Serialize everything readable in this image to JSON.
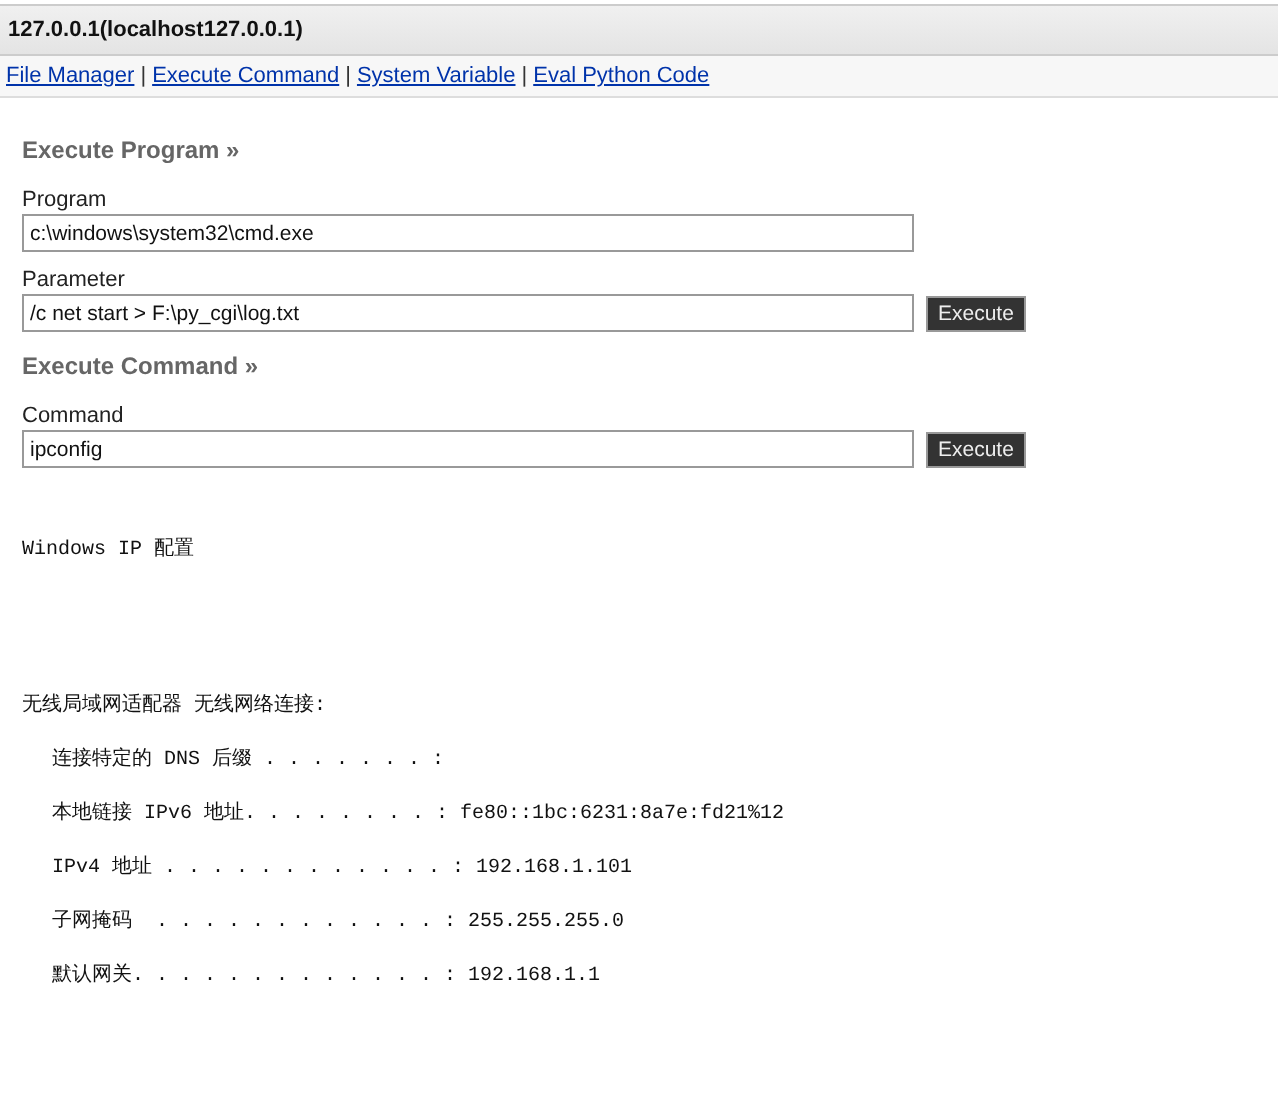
{
  "title": "127.0.0.1(localhost127.0.0.1)",
  "nav": [
    "File Manager",
    "Execute Command",
    "System Variable",
    "Eval Python Code"
  ],
  "nav_separators": [
    "|",
    "|",
    "|"
  ],
  "sections": [
    {
      "heading": "Execute Program »",
      "fields": [
        {
          "label": "Program",
          "value": "c:\\windows\\system32\\cmd.exe"
        },
        {
          "label": "Parameter",
          "value": "/c net start > F:\\py_cgi\\log.txt",
          "button": "Execute"
        }
      ]
    },
    {
      "heading": "Execute Command »",
      "fields": [
        {
          "label": "Command",
          "value": "ipconfig",
          "button": "Execute"
        }
      ]
    }
  ],
  "output": [
    {
      "kind": "heading",
      "text": "Windows IP 配置"
    },
    {
      "kind": "adapter",
      "text": "无线局域网适配器 无线网络连接:"
    },
    {
      "kind": "entry",
      "text": "连接特定的 DNS 后缀 . . . . . . . :"
    },
    {
      "kind": "entry",
      "text": "本地链接 IPv6 地址. . . . . . . . : fe80::1bc:6231:8a7e:fd21%12"
    },
    {
      "kind": "entry",
      "text": "IPv4 地址 . . . . . . . . . . . . : 192.168.1.101"
    },
    {
      "kind": "entry",
      "text": "子网掩码  . . . . . . . . . . . . : 255.255.255.0"
    },
    {
      "kind": "entry",
      "text": "默认网关. . . . . . . . . . . . . : 192.168.1.1"
    }
  ]
}
